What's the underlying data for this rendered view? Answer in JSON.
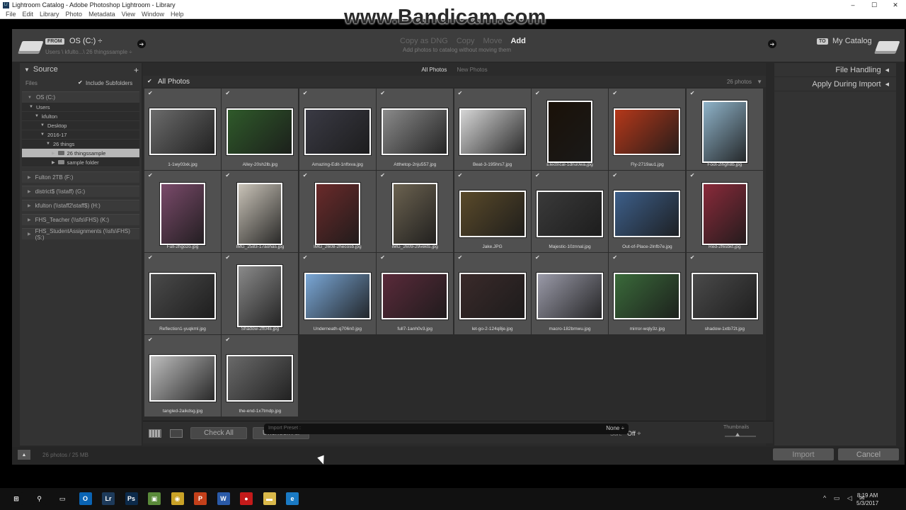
{
  "window": {
    "title": "Lightroom Catalog - Adobe Photoshop Lightroom - Library",
    "app_icon": "Lr",
    "controls": [
      "–",
      "☐",
      "✕"
    ],
    "menu": [
      "File",
      "Edit",
      "Library",
      "Photo",
      "Metadata",
      "View",
      "Window",
      "Help"
    ]
  },
  "watermark": "www.Bandicam.com",
  "topbar": {
    "from_badge": "FROM",
    "from_source": "OS (C:) ÷",
    "from_path": "Users \\ kfulto...\\ 26 thingssample ÷",
    "modes": [
      "Copy as DNG",
      "Copy",
      "Move",
      "Add"
    ],
    "active_mode": "Add",
    "mode_description": "Add photos to catalog without moving them",
    "to_badge": "TO",
    "to_destination": "My Catalog"
  },
  "source": {
    "title": "Source",
    "files_label": "Files",
    "include_subfolders": "Include Subfolders",
    "volume_os": "OS (C:)",
    "tree": [
      {
        "label": "Users",
        "indent": 0,
        "open": true,
        "selected": false,
        "folder": false
      },
      {
        "label": "kfulton",
        "indent": 1,
        "open": true,
        "selected": false,
        "folder": false
      },
      {
        "label": "Desktop",
        "indent": 2,
        "open": true,
        "selected": false,
        "folder": false
      },
      {
        "label": "2016-17",
        "indent": 2,
        "open": true,
        "selected": false,
        "folder": false
      },
      {
        "label": "26 things",
        "indent": 3,
        "open": true,
        "selected": false,
        "folder": false
      },
      {
        "label": "26 thingssample",
        "indent": 4,
        "open": false,
        "selected": true,
        "folder": true
      },
      {
        "label": "sample folder",
        "indent": 4,
        "open": false,
        "selected": false,
        "folder": true
      }
    ],
    "volumes": [
      "Fulton 2TB (F:)",
      "district$ (\\\\staff) (G:)",
      "kfulton (\\\\staff2\\staff$) (H:)",
      "FHS_Teacher (\\\\sfs\\FHS) (K:)",
      "FHS_StudentAssignments (\\\\sfs\\FHS) (S:)"
    ]
  },
  "grid": {
    "tabs": [
      "All Photos",
      "New Photos"
    ],
    "active_tab": "All Photos",
    "header": "All Photos",
    "count": "26 photos",
    "photos": [
      {
        "name": "1-1wy03xk.jpg",
        "orient": "land",
        "color": "#6b6b6b"
      },
      {
        "name": "Alley-20sh2lb.jpg",
        "orient": "land",
        "color": "#2f5a2a"
      },
      {
        "name": "Amazing-Edit-1nftxva.jpg",
        "orient": "land",
        "color": "#3a3a44"
      },
      {
        "name": "Atthetop-2nju557.jpg",
        "orient": "land",
        "color": "#8a8a8a"
      },
      {
        "name": "Beat-3-195hrs7.jpg",
        "orient": "land",
        "color": "#d6d6d6"
      },
      {
        "name": "Electrical-1dnu0wa.jpg",
        "orient": "port",
        "color": "#1a1108"
      },
      {
        "name": "Fly-2719au1.jpg",
        "orient": "land",
        "color": "#b5381a"
      },
      {
        "name": "Foot-2lhgh8b.jpg",
        "orient": "port",
        "color": "#8fb3c9"
      },
      {
        "name": "Full-2hgo2o.jpg",
        "orient": "port",
        "color": "#7a4a6a"
      },
      {
        "name": "IMG_2583-17aohas.jpg",
        "orient": "port",
        "color": "#c9c3b8"
      },
      {
        "name": "IMG_2608-2hecosb.jpg",
        "orient": "port",
        "color": "#6a2a2a"
      },
      {
        "name": "IMG_2609-29vekts.jpg",
        "orient": "port",
        "color": "#6b6250"
      },
      {
        "name": "Jake.JPG",
        "orient": "land",
        "color": "#5a4a2a"
      },
      {
        "name": "Majestic-10znnal.jpg",
        "orient": "land",
        "color": "#3a3a3a"
      },
      {
        "name": "Out-of-Place-2lnfb7e.jpg",
        "orient": "land",
        "color": "#3d5f8a"
      },
      {
        "name": "Red-2f6sbkt.jpg",
        "orient": "port",
        "color": "#8a2a3a"
      },
      {
        "name": "Reflection1-yuqkml.jpg",
        "orient": "land",
        "color": "#4a4a4a"
      },
      {
        "name": "Shadow-2ft04li.jpg",
        "orient": "port",
        "color": "#8a8a8a"
      },
      {
        "name": "Underneath-q706n0.jpg",
        "orient": "land",
        "color": "#7aa7d6"
      },
      {
        "name": "full7-1anh0v3.jpg",
        "orient": "land",
        "color": "#5a2a3a"
      },
      {
        "name": "let-go-2-124q8je.jpg",
        "orient": "land",
        "color": "#3a2a2a"
      },
      {
        "name": "macro-182bmwu.jpg",
        "orient": "land",
        "color": "#9a9aa8"
      },
      {
        "name": "mirror-wqly3z.jpg",
        "orient": "land",
        "color": "#3a6a3a"
      },
      {
        "name": "shadow-1xtb72t.jpg",
        "orient": "land",
        "color": "#4a4a4a"
      },
      {
        "name": "tangled-2aikdsg.jpg",
        "orient": "land",
        "color": "#bdbdbd"
      },
      {
        "name": "the-end-1x7tmdp.jpg",
        "orient": "land",
        "color": "#6a6a6a"
      }
    ]
  },
  "toolbar": {
    "check_all": "Check All",
    "uncheck_all": "Uncheck All",
    "sort_label": "Sort:",
    "sort_value": "Off ÷",
    "thumbnails_label": "Thumbnails",
    "thumbnail_size_fraction": 0.4
  },
  "right_panel": {
    "file_handling": "File Handling",
    "apply_during_import": "Apply During Import"
  },
  "bottom": {
    "photo_count": "26 photos / 25 MB",
    "import_preset_label": "Import Preset :",
    "import_preset_value": "None ÷",
    "import": "Import",
    "cancel": "Cancel"
  },
  "taskbar": {
    "time": "8:19 AM",
    "date": "5/3/2017",
    "apps": [
      {
        "name": "windows-start-icon",
        "glyph": "⊞",
        "color": "#111"
      },
      {
        "name": "search-icon",
        "glyph": "⚲",
        "color": "#111"
      },
      {
        "name": "task-view-icon",
        "glyph": "▭",
        "color": "#111"
      },
      {
        "name": "outlook-icon",
        "glyph": "O",
        "color": "#0a64b4"
      },
      {
        "name": "lightroom-icon",
        "glyph": "Lr",
        "color": "#1d3a5a"
      },
      {
        "name": "photoshop-icon",
        "glyph": "Ps",
        "color": "#0c2a4a"
      },
      {
        "name": "app-green-icon",
        "glyph": "▣",
        "color": "#5a8a3a"
      },
      {
        "name": "chrome-icon",
        "glyph": "◉",
        "color": "#c9a227"
      },
      {
        "name": "powerpoint-icon",
        "glyph": "P",
        "color": "#c4401a"
      },
      {
        "name": "word-icon",
        "glyph": "W",
        "color": "#2a5aa8"
      },
      {
        "name": "record-icon",
        "glyph": "●",
        "color": "#c41a1a"
      },
      {
        "name": "file-explorer-icon",
        "glyph": "▬",
        "color": "#d9b84a"
      },
      {
        "name": "edge-icon",
        "glyph": "e",
        "color": "#1a7ac4"
      }
    ]
  }
}
